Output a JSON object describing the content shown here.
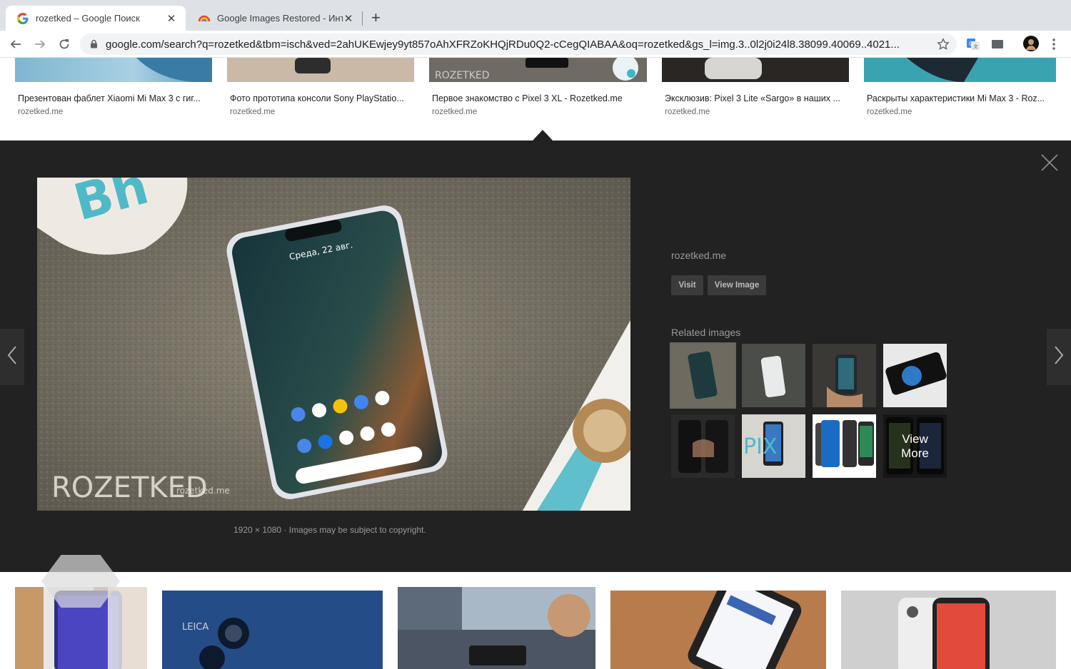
{
  "browser": {
    "tabs": [
      {
        "title": "rozetked – Google Поиск",
        "active": true,
        "favicon": "google-g-icon"
      },
      {
        "title": "Google Images Restored - Инт",
        "active": false,
        "favicon": "chrome-ext-rainbow-icon"
      }
    ],
    "new_tab_symbol": "+",
    "url": "google.com/search?q=rozetked&tbm=isch&ved=2ahUKEwjey9yt857oAhXFRZoKHQjRDu0Q2-cCegQIABAA&oq=rozetked&gs_l=img.3..0l2j0i24l8.38099.40069..4021..."
  },
  "results_top": [
    {
      "caption": "Презентован фаблет Xiaomi Mi Max 3 с гиг...",
      "source": "rozetked.me"
    },
    {
      "caption": "Фото прототипа консоли Sony PlayStatio...",
      "source": "rozetked.me"
    },
    {
      "caption": "Первое знакомство с Pixel 3 XL - Rozetked.me",
      "source": "rozetked.me"
    },
    {
      "caption": "Эксклюзив: Pixel 3 Lite «Sargo» в наших ...",
      "source": "rozetked.me"
    },
    {
      "caption": "Раскрыты характеристики Mi Max 3 - Roz...",
      "source": "rozetked.me"
    }
  ],
  "viewer": {
    "site": "rozetked.me",
    "visit_label": "Visit",
    "view_image_label": "View Image",
    "related_label": "Related images",
    "meta": "1920 × 1080 · Images may be subject to copyright.",
    "view_more_label": "View More",
    "phone_date": "Среда, 22 авг.",
    "watermark": "ROZETKED",
    "watermark_sub": "rozetked.me"
  },
  "colors": {
    "viewer_bg": "#222222",
    "button_bg": "#3b3b3b",
    "muted_text": "#9a9a9a"
  }
}
